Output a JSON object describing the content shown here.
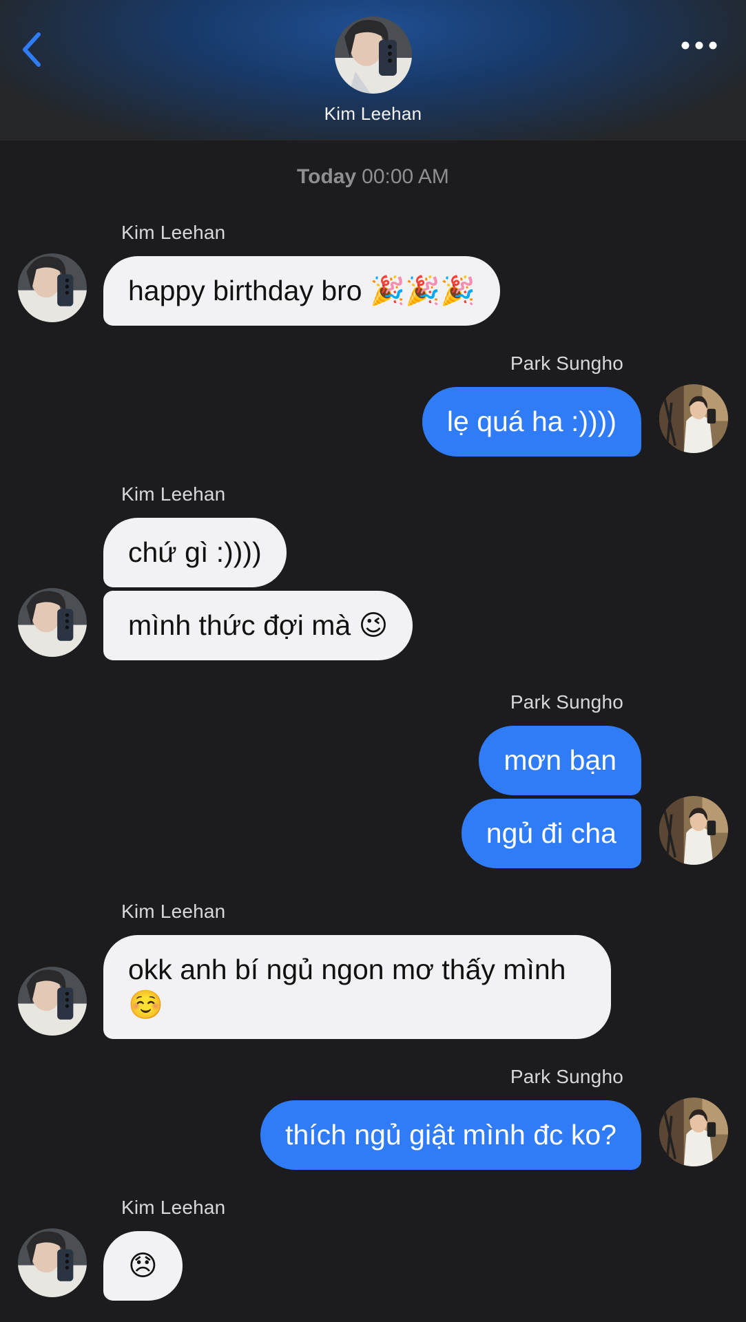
{
  "header": {
    "contact_name": "Kim Leehan",
    "back_icon": "chevron-left-icon",
    "more_icon": "ellipsis-icon",
    "accent_color": "#2f7cf6"
  },
  "chat": {
    "timestamp_day": "Today",
    "timestamp_time": "00:00 AM",
    "participants": {
      "them": "Kim Leehan",
      "me": "Park Sungho"
    },
    "messages": [
      {
        "sender": "Kim Leehan",
        "text": "happy birthday bro 🎉🎉🎉"
      },
      {
        "sender": "Park Sungho",
        "text": "lẹ quá ha :))))"
      },
      {
        "sender": "Kim Leehan",
        "text": "chứ gì :))))"
      },
      {
        "sender": "Kim Leehan",
        "text": "mình thức đợi mà 😉"
      },
      {
        "sender": "Park Sungho",
        "text": "mơn bạn"
      },
      {
        "sender": "Park Sungho",
        "text": "ngủ đi cha"
      },
      {
        "sender": "Kim Leehan",
        "text": "okk anh bí ngủ ngon mơ thấy mình ☺️"
      },
      {
        "sender": "Park Sungho",
        "text": "thích ngủ giật mình đc ko?"
      },
      {
        "sender": "Kim Leehan",
        "text": "😞"
      }
    ],
    "incoming_bubble_color": "#f2f2f4",
    "outgoing_bubble_color": "#2f7cf6"
  }
}
